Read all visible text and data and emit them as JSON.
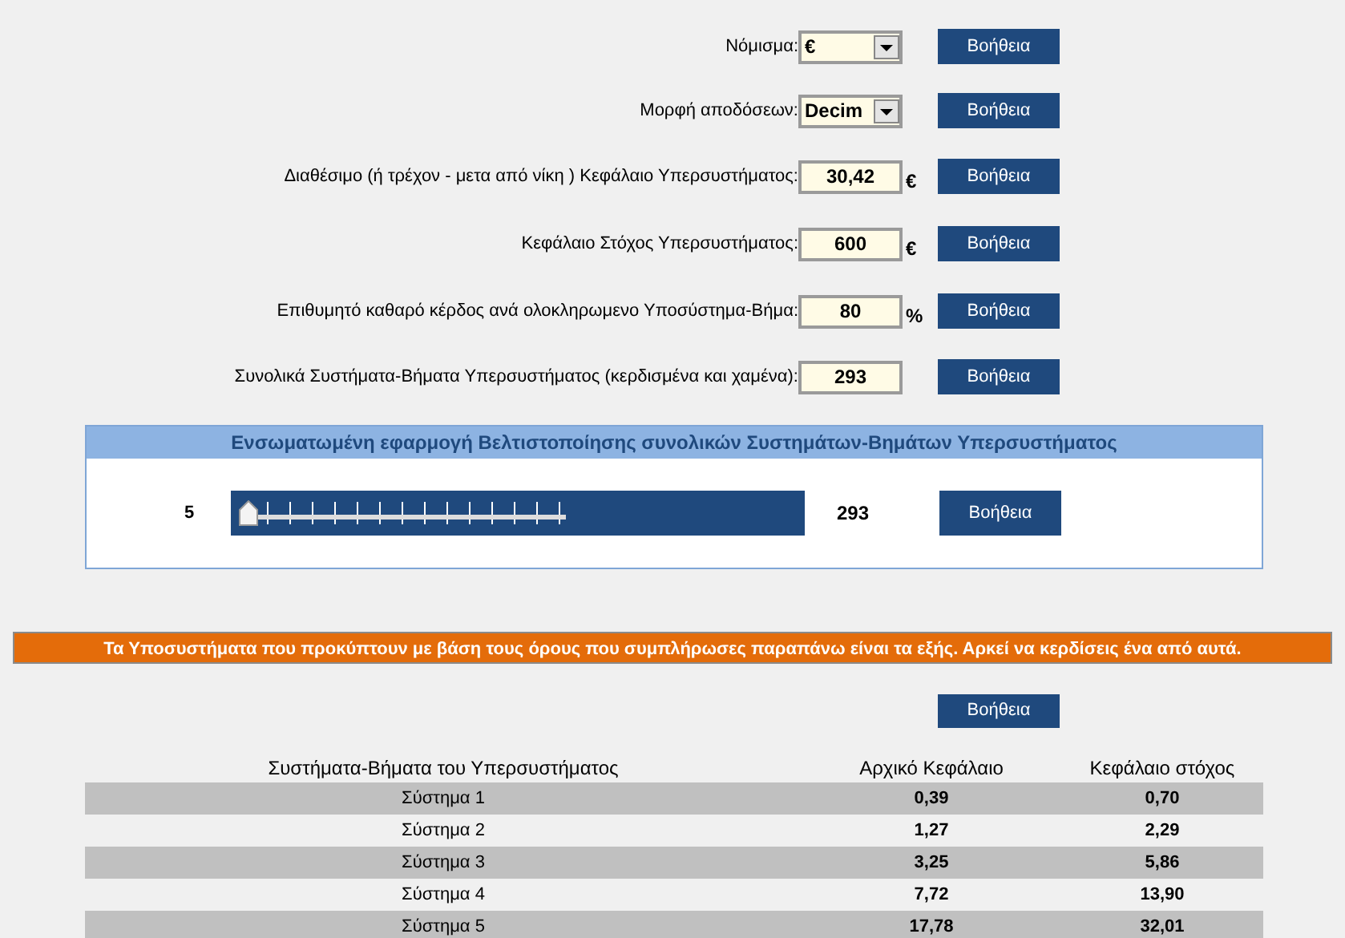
{
  "form_rows": [
    {
      "label": "Νόμισμα:",
      "kind": "select",
      "value": "€",
      "help": "Βοήθεια"
    },
    {
      "label": "Μορφή αποδόσεων:",
      "kind": "select",
      "value": "Decim",
      "help": "Βοήθεια"
    },
    {
      "label": "Διαθέσιμο (ή τρέχον - μετα από νίκη ) Κεφάλαιο Υπερσυστήματος:",
      "kind": "input",
      "value": "30,42",
      "unit": "€",
      "help": "Βοήθεια"
    },
    {
      "label": "Κεφάλαιο Στόχος Υπερσυστήματος:",
      "kind": "input",
      "value": "600",
      "unit": "€",
      "help": "Βοήθεια"
    },
    {
      "label": "Επιθυμητό καθαρό κέρδος ανά ολοκληρωμενο Υποσύστημα-Βήμα:",
      "kind": "input",
      "value": "80",
      "unit": "%",
      "help": "Βοήθεια"
    },
    {
      "label": "Συνολικά Συστήματα-Βήματα Υπερσυστήματος (κερδισμένα και χαμένα):",
      "kind": "input",
      "value": "293",
      "help": "Βοήθεια"
    }
  ],
  "optimizer": {
    "title": "Ενσωματωμένη εφαρμογή Βελτιστοποίησης συνολικών Συστημάτων-Βημάτων Υπερσυστήματος",
    "min_label": "5",
    "level": 0,
    "max_label": "293",
    "help": "Βοήθεια"
  },
  "banner": "Τα Υποσυστήματα που προκύπτουν με βάση τους όρους που συμπλήρωσες παραπάνω είναι τα εξής. Αρκεί να κερδίσεις ένα από αυτά.",
  "results_help": "Βοήθεια",
  "table": {
    "columns": [
      "Συστήματα-Βήματα του Υπερσυστήματος",
      "Αρχικό Κεφάλαιο",
      "Κεφάλαιο στόχος"
    ],
    "rows": [
      [
        "Σύστημα 1",
        "0,39",
        "0,70"
      ],
      [
        "Σύστημα 2",
        "1,27",
        "2,29"
      ],
      [
        "Σύστημα 3",
        "3,25",
        "5,86"
      ],
      [
        "Σύστημα 4",
        "7,72",
        "13,90"
      ],
      [
        "Σύστημα 5",
        "17,78",
        "32,01"
      ]
    ]
  }
}
